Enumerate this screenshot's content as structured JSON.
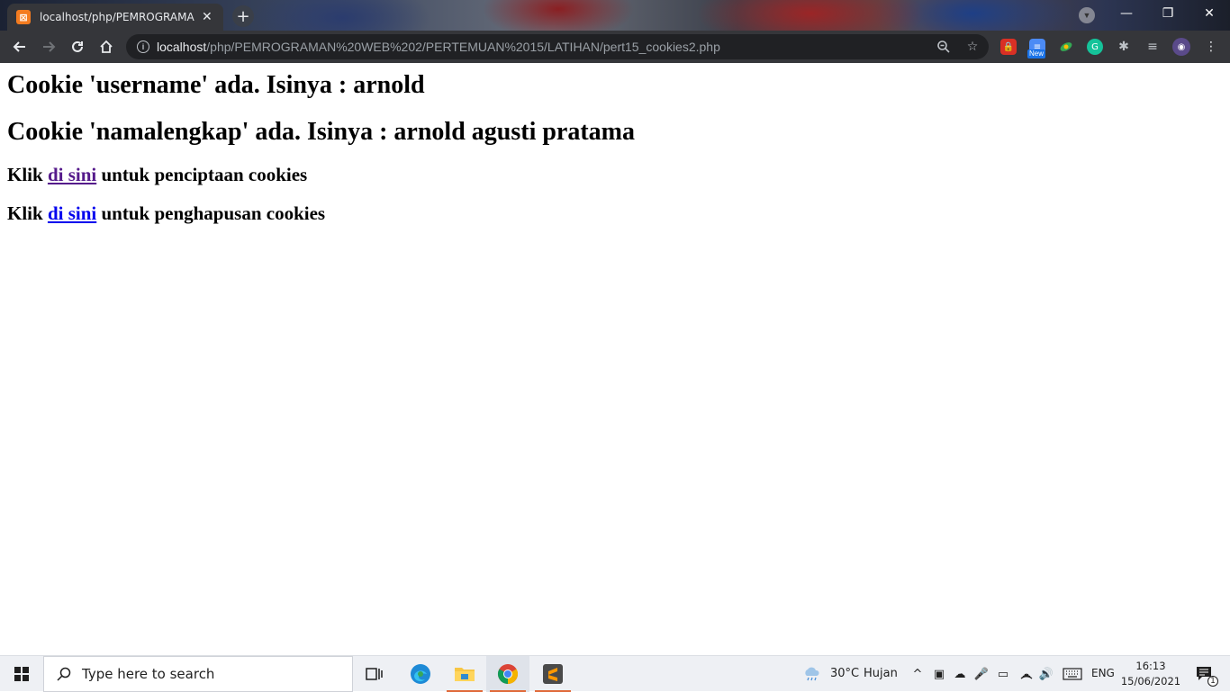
{
  "browser": {
    "tab_title": "localhost/php/PEMROGRAMAN W",
    "tab_close": "✕",
    "new_tab": "+",
    "url_host": "localhost",
    "url_path": "/php/PEMROGRAMAN%20WEB%202/PERTEMUAN%2015/LATIHAN/pert15_cookies2.php",
    "extension_badge": "New",
    "window_controls": {
      "minimize": "—",
      "restore": "❐",
      "close": "✕"
    }
  },
  "page": {
    "line1": "Cookie 'username' ada. Isinya : arnold",
    "line2": "Cookie 'namalengkap' ada. Isinya : arnold agusti pratama",
    "line3": {
      "prefix": "Klik ",
      "link": "di sini",
      "suffix": " untuk penciptaan cookies"
    },
    "line4": {
      "prefix": "Klik ",
      "link": "di sini",
      "suffix": " untuk penghapusan cookies"
    }
  },
  "taskbar": {
    "search_placeholder": "Type here to search",
    "weather_temp": "30°C",
    "weather_desc": "Hujan",
    "language": "ENG",
    "time": "16:13",
    "date": "15/06/2021",
    "notification_count": "1"
  }
}
